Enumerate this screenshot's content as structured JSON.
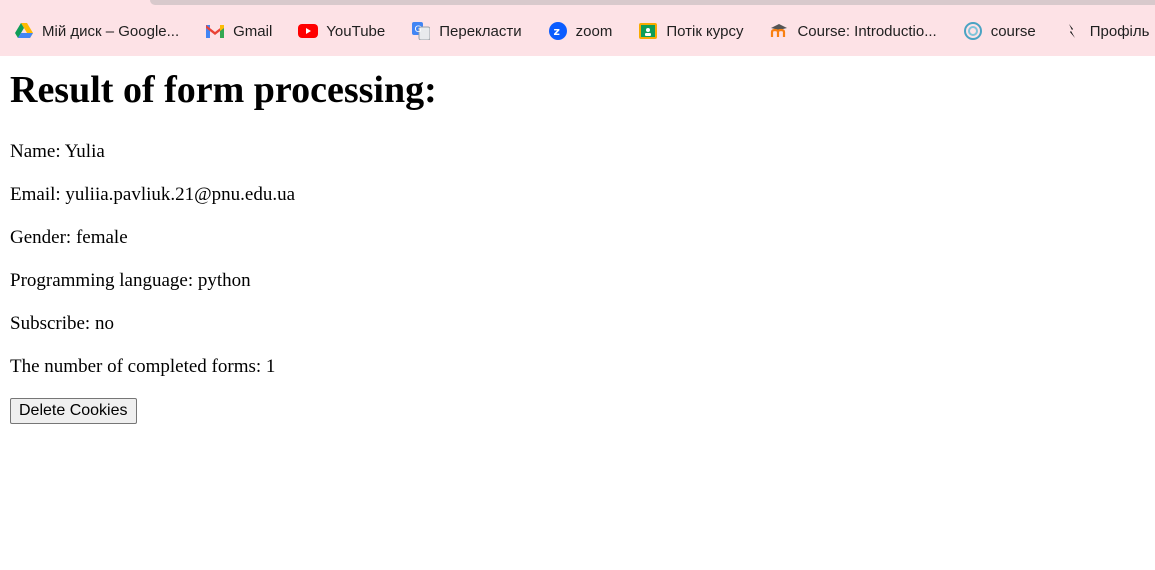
{
  "bookmarks": [
    {
      "label": "Мій диск – Google...",
      "icon": "google-drive-icon"
    },
    {
      "label": "Gmail",
      "icon": "gmail-icon"
    },
    {
      "label": "YouTube",
      "icon": "youtube-icon"
    },
    {
      "label": "Перекласти",
      "icon": "google-translate-icon"
    },
    {
      "label": "zoom",
      "icon": "zoom-icon"
    },
    {
      "label": "Потік курсу",
      "icon": "google-classroom-icon"
    },
    {
      "label": "Course: Introductio...",
      "icon": "moodle-icon"
    },
    {
      "label": "course",
      "icon": "course-site-icon"
    },
    {
      "label": "Профіль",
      "icon": "profile-icon"
    }
  ],
  "page": {
    "title": "Result of form processing:",
    "lines": {
      "name": "Name: Yulia",
      "email": "Email: yuliia.pavliuk.21@pnu.edu.ua",
      "gender": "Gender: female",
      "language": "Programming language: python",
      "subscribe": "Subscribe: no",
      "count": "The number of completed forms: 1"
    },
    "delete_button": "Delete Cookies"
  },
  "colors": {
    "bookmark_bar_bg": "#fde2e6",
    "youtube_red": "#ff0000",
    "zoom_blue": "#0b5cff"
  }
}
